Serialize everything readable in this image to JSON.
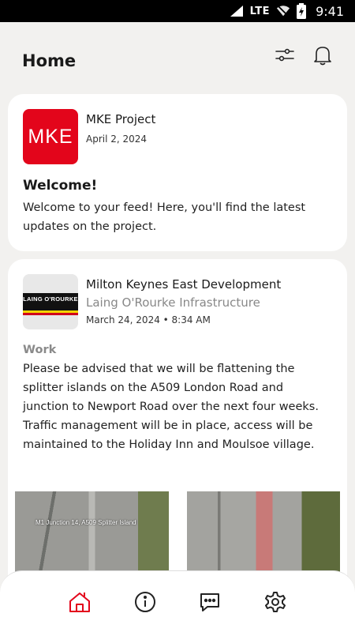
{
  "status_bar": {
    "network": "LTE",
    "time": "9:41",
    "icons": [
      "signal-icon",
      "wifi-off-icon",
      "battery-charging-icon"
    ]
  },
  "header": {
    "title": "Home",
    "icons": [
      "filter-sliders-icon",
      "bell-icon"
    ]
  },
  "posts": [
    {
      "logo_text": "MKE",
      "author": "MKE Project",
      "date": "April 2, 2024",
      "title": "Welcome!",
      "body": "Welcome to your feed! Here, you'll find the latest updates on the project."
    },
    {
      "logo_text": "LAING O'ROURKE",
      "author": "Milton Keynes East Development",
      "organisation": "Laing O'Rourke Infrastructure",
      "date": "March 24, 2024 • 8:34 AM",
      "category": "Work",
      "body": "Please be advised that we will be flattening the splitter islands on the A509 London Road and junction to Newport Road over the next four weeks. Traffic management will be in place, access will be maintained to the Holiday Inn and Moulsoe village.",
      "images": [
        {
          "caption": "M1 Junction 14, A509 Splitter Island"
        },
        {
          "caption": ""
        }
      ]
    }
  ],
  "bottom_nav": {
    "items": [
      {
        "icon": "home-icon",
        "active": true
      },
      {
        "icon": "info-icon",
        "active": false
      },
      {
        "icon": "chat-icon",
        "active": false
      },
      {
        "icon": "settings-icon",
        "active": false
      }
    ],
    "active_color": "#e3051b"
  },
  "colors": {
    "brand_red": "#e3051b",
    "background": "#f2f1ef"
  }
}
